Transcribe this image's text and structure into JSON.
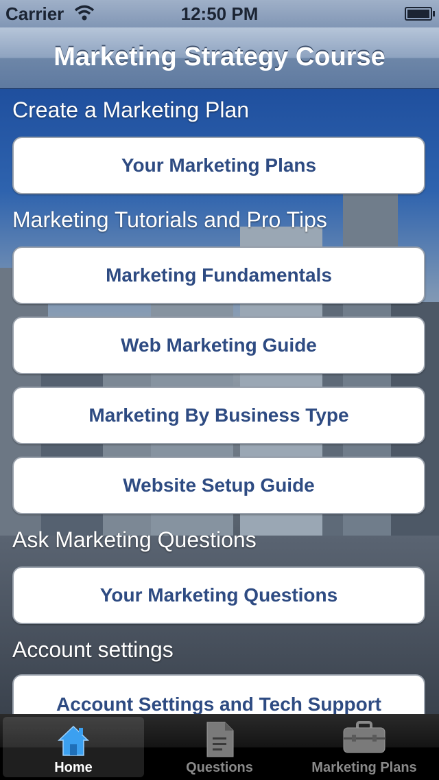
{
  "status_bar": {
    "carrier": "Carrier",
    "time": "12:50 PM"
  },
  "nav": {
    "title": "Marketing Strategy Course"
  },
  "sections": {
    "plan": "Create a Marketing Plan",
    "tutorials": "Marketing Tutorials and Pro Tips",
    "questions": "Ask Marketing Questions",
    "account": "Account settings"
  },
  "buttons": {
    "plans": "Your Marketing Plans",
    "fundamentals": "Marketing Fundamentals",
    "web_guide": "Web Marketing Guide",
    "business_type": "Marketing By Business Type",
    "website_setup": "Website Setup Guide",
    "your_questions": "Your Marketing Questions",
    "account_support": "Account Settings and Tech Support"
  },
  "tabs": [
    {
      "label": "Home",
      "icon": "home-icon",
      "active": true
    },
    {
      "label": "Questions",
      "icon": "document-icon",
      "active": false
    },
    {
      "label": "Marketing Plans",
      "icon": "briefcase-icon",
      "active": false
    }
  ],
  "colors": {
    "button_text": "#2e4b82",
    "nav_bar": "#6d86a8",
    "tab_active_icon": "#3ba0f0"
  }
}
